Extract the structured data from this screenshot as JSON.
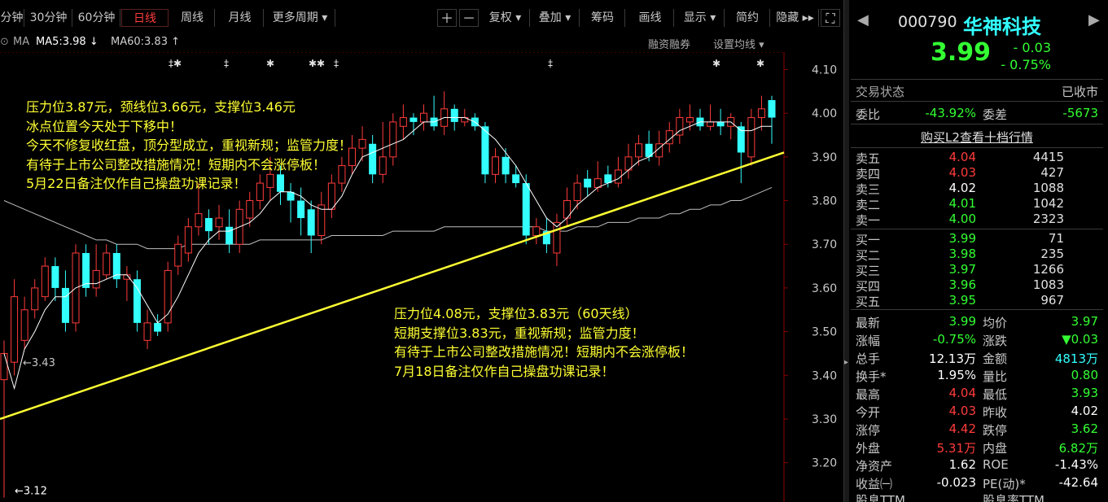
{
  "toolbar": {
    "periods": [
      "分钟",
      "30分钟",
      "60分钟",
      "日线",
      "周线",
      "月线",
      "更多周期 ▾"
    ],
    "tools": [
      "复权 ▾",
      "叠加 ▾",
      "筹码",
      "画线",
      "显示 ▾",
      "简约",
      "隐藏 ▸▸"
    ]
  },
  "ma_bar": {
    "ma_label": "MA",
    "ma5": "MA5:3.98 ↓",
    "ma60": "MA60:3.83 ↑",
    "rzrq": "融资融券",
    "set_ma": "设置均线 ▾"
  },
  "notes": {
    "top": [
      "压力位3.87元，颈线位3.66元，支撑位3.46元",
      "冰点位置今天处于下移中！",
      "今天不修复收红盘，顶分型成立，重视新规；监管力度！",
      "有待于上市公司整改措施情况！短期内不会涨停板！",
      "5月22日备注仅作自己操盘功课记录！"
    ],
    "bottom": [
      "压力位4.08元，支撑位3.83元（60天线）",
      "短期支撑位3.83元，重视新规；监管力度！",
      "有待于上市公司整改措施情况！短期内不会涨停板！",
      "7月18日备注仅作自己操盘功课记录！"
    ]
  },
  "chart_data": {
    "type": "candlestick",
    "yticks": [
      "4.10",
      "4.00",
      "3.90",
      "3.80",
      "3.70",
      "3.60",
      "3.50",
      "3.40",
      "3.30",
      "3.20"
    ],
    "ylim": [
      3.11,
      4.14
    ],
    "annotations": [
      "←3.43",
      "←3.12"
    ],
    "candles": [
      {
        "o": 3.39,
        "c": 3.45,
        "h": 3.48,
        "l": 3.12
      },
      {
        "o": 3.43,
        "c": 3.58,
        "h": 3.62,
        "l": 3.4
      },
      {
        "o": 3.48,
        "c": 3.55,
        "h": 3.58,
        "l": 3.46
      },
      {
        "o": 3.55,
        "c": 3.6,
        "h": 3.62,
        "l": 3.53
      },
      {
        "o": 3.58,
        "c": 3.65,
        "h": 3.67,
        "l": 3.57
      },
      {
        "o": 3.65,
        "c": 3.6,
        "h": 3.67,
        "l": 3.57
      },
      {
        "o": 3.6,
        "c": 3.52,
        "h": 3.64,
        "l": 3.5
      },
      {
        "o": 3.52,
        "c": 3.68,
        "h": 3.7,
        "l": 3.5
      },
      {
        "o": 3.68,
        "c": 3.6,
        "h": 3.7,
        "l": 3.58
      },
      {
        "o": 3.6,
        "c": 3.64,
        "h": 3.7,
        "l": 3.58
      },
      {
        "o": 3.63,
        "c": 3.68,
        "h": 3.7,
        "l": 3.62
      },
      {
        "o": 3.68,
        "c": 3.62,
        "h": 3.7,
        "l": 3.6
      },
      {
        "o": 3.62,
        "c": 3.63,
        "h": 3.65,
        "l": 3.57
      },
      {
        "o": 3.62,
        "c": 3.52,
        "h": 3.64,
        "l": 3.5
      },
      {
        "o": 3.48,
        "c": 3.52,
        "h": 3.55,
        "l": 3.46
      },
      {
        "o": 3.52,
        "c": 3.5,
        "h": 3.54,
        "l": 3.49
      },
      {
        "o": 3.52,
        "c": 3.64,
        "h": 3.66,
        "l": 3.5
      },
      {
        "o": 3.65,
        "c": 3.7,
        "h": 3.72,
        "l": 3.63
      },
      {
        "o": 3.68,
        "c": 3.74,
        "h": 3.76,
        "l": 3.66
      },
      {
        "o": 3.74,
        "c": 3.77,
        "h": 3.84,
        "l": 3.72
      },
      {
        "o": 3.76,
        "c": 3.73,
        "h": 3.78,
        "l": 3.7
      },
      {
        "o": 3.74,
        "c": 3.76,
        "h": 3.79,
        "l": 3.71
      },
      {
        "o": 3.74,
        "c": 3.7,
        "h": 3.78,
        "l": 3.68
      },
      {
        "o": 3.7,
        "c": 3.78,
        "h": 3.8,
        "l": 3.68
      },
      {
        "o": 3.76,
        "c": 3.8,
        "h": 3.82,
        "l": 3.74
      },
      {
        "o": 3.8,
        "c": 3.84,
        "h": 3.86,
        "l": 3.78
      },
      {
        "o": 3.83,
        "c": 3.86,
        "h": 3.9,
        "l": 3.8
      },
      {
        "o": 3.86,
        "c": 3.82,
        "h": 3.88,
        "l": 3.79
      },
      {
        "o": 3.82,
        "c": 3.8,
        "h": 3.84,
        "l": 3.75
      },
      {
        "o": 3.8,
        "c": 3.76,
        "h": 3.83,
        "l": 3.72
      },
      {
        "o": 3.78,
        "c": 3.72,
        "h": 3.8,
        "l": 3.68
      },
      {
        "o": 3.72,
        "c": 3.79,
        "h": 3.82,
        "l": 3.7
      },
      {
        "o": 3.78,
        "c": 3.84,
        "h": 3.86,
        "l": 3.76
      },
      {
        "o": 3.84,
        "c": 3.88,
        "h": 3.9,
        "l": 3.82
      },
      {
        "o": 3.88,
        "c": 3.92,
        "h": 3.95,
        "l": 3.86
      },
      {
        "o": 3.92,
        "c": 3.94,
        "h": 3.97,
        "l": 3.89
      },
      {
        "o": 3.93,
        "c": 3.86,
        "h": 3.95,
        "l": 3.84
      },
      {
        "o": 3.86,
        "c": 3.9,
        "h": 3.98,
        "l": 3.84
      },
      {
        "o": 3.9,
        "c": 3.98,
        "h": 4.0,
        "l": 3.88
      },
      {
        "o": 3.97,
        "c": 3.99,
        "h": 4.02,
        "l": 3.94
      },
      {
        "o": 3.99,
        "c": 3.98,
        "h": 4.0,
        "l": 3.95
      },
      {
        "o": 3.98,
        "c": 4.0,
        "h": 4.02,
        "l": 3.96
      },
      {
        "o": 3.99,
        "c": 3.97,
        "h": 4.04,
        "l": 3.96
      },
      {
        "o": 3.97,
        "c": 4.01,
        "h": 4.05,
        "l": 3.95
      },
      {
        "o": 4.01,
        "c": 3.98,
        "h": 4.02,
        "l": 3.96
      },
      {
        "o": 3.98,
        "c": 3.99,
        "h": 4.01,
        "l": 3.97
      },
      {
        "o": 3.99,
        "c": 3.97,
        "h": 4.0,
        "l": 3.96
      },
      {
        "o": 3.97,
        "c": 3.86,
        "h": 3.98,
        "l": 3.84
      },
      {
        "o": 3.86,
        "c": 3.9,
        "h": 3.92,
        "l": 3.84
      },
      {
        "o": 3.9,
        "c": 3.86,
        "h": 3.92,
        "l": 3.84
      },
      {
        "o": 3.86,
        "c": 3.84,
        "h": 3.88,
        "l": 3.83
      },
      {
        "o": 3.84,
        "c": 3.72,
        "h": 3.86,
        "l": 3.7
      },
      {
        "o": 3.72,
        "c": 3.74,
        "h": 3.76,
        "l": 3.7
      },
      {
        "o": 3.73,
        "c": 3.7,
        "h": 3.76,
        "l": 3.68
      },
      {
        "o": 3.68,
        "c": 3.75,
        "h": 3.77,
        "l": 3.65
      },
      {
        "o": 3.76,
        "c": 3.8,
        "h": 3.83,
        "l": 3.74
      },
      {
        "o": 3.8,
        "c": 3.84,
        "h": 3.86,
        "l": 3.78
      },
      {
        "o": 3.85,
        "c": 3.83,
        "h": 3.87,
        "l": 3.81
      },
      {
        "o": 3.83,
        "c": 3.85,
        "h": 3.89,
        "l": 3.82
      },
      {
        "o": 3.86,
        "c": 3.84,
        "h": 3.88,
        "l": 3.83
      },
      {
        "o": 3.84,
        "c": 3.87,
        "h": 3.9,
        "l": 3.83
      },
      {
        "o": 3.87,
        "c": 3.9,
        "h": 3.93,
        "l": 3.85
      },
      {
        "o": 3.9,
        "c": 3.93,
        "h": 3.95,
        "l": 3.88
      },
      {
        "o": 3.93,
        "c": 3.9,
        "h": 3.96,
        "l": 3.89
      },
      {
        "o": 3.9,
        "c": 3.93,
        "h": 3.96,
        "l": 3.88
      },
      {
        "o": 3.93,
        "c": 3.96,
        "h": 3.98,
        "l": 3.91
      },
      {
        "o": 3.95,
        "c": 3.99,
        "h": 4.01,
        "l": 3.93
      },
      {
        "o": 3.98,
        "c": 3.99,
        "h": 4.02,
        "l": 3.96
      },
      {
        "o": 3.99,
        "c": 3.97,
        "h": 4.01,
        "l": 3.96
      },
      {
        "o": 3.97,
        "c": 3.98,
        "h": 4.02,
        "l": 3.96
      },
      {
        "o": 3.98,
        "c": 3.97,
        "h": 4.01,
        "l": 3.95
      },
      {
        "o": 3.97,
        "c": 3.99,
        "h": 4.0,
        "l": 3.94
      },
      {
        "o": 3.97,
        "c": 3.91,
        "h": 3.98,
        "l": 3.84
      },
      {
        "o": 3.9,
        "c": 3.99,
        "h": 4.01,
        "l": 3.88
      },
      {
        "o": 3.99,
        "c": 4.01,
        "h": 4.04,
        "l": 3.96
      },
      {
        "o": 4.03,
        "c": 3.99,
        "h": 4.04,
        "l": 3.93
      }
    ],
    "ma5": [
      3.45,
      3.37,
      3.46,
      3.5,
      3.55,
      3.58,
      3.58,
      3.6,
      3.61,
      3.61,
      3.62,
      3.63,
      3.63,
      3.6,
      3.56,
      3.52,
      3.54,
      3.58,
      3.63,
      3.68,
      3.71,
      3.73,
      3.73,
      3.74,
      3.75,
      3.77,
      3.8,
      3.82,
      3.82,
      3.81,
      3.79,
      3.78,
      3.78,
      3.81,
      3.86,
      3.9,
      3.91,
      3.92,
      3.93,
      3.94,
      3.96,
      3.98,
      3.98,
      3.99,
      3.99,
      3.99,
      3.98,
      3.96,
      3.94,
      3.91,
      3.88,
      3.84,
      3.8,
      3.76,
      3.74,
      3.76,
      3.79,
      3.81,
      3.83,
      3.84,
      3.85,
      3.87,
      3.89,
      3.9,
      3.92,
      3.94,
      3.96,
      3.97,
      3.98,
      3.98,
      3.98,
      3.98,
      3.96,
      3.96,
      3.97,
      3.97
    ],
    "ma60": [
      3.8,
      3.79,
      3.78,
      3.77,
      3.76,
      3.75,
      3.74,
      3.73,
      3.72,
      3.71,
      3.71,
      3.7,
      3.7,
      3.7,
      3.69,
      3.69,
      3.69,
      3.69,
      3.7,
      3.7,
      3.7,
      3.7,
      3.7,
      3.7,
      3.7,
      3.71,
      3.71,
      3.71,
      3.71,
      3.71,
      3.71,
      3.71,
      3.72,
      3.72,
      3.72,
      3.72,
      3.72,
      3.72,
      3.73,
      3.73,
      3.73,
      3.73,
      3.73,
      3.74,
      3.74,
      3.74,
      3.74,
      3.74,
      3.74,
      3.74,
      3.74,
      3.74,
      3.74,
      3.73,
      3.73,
      3.73,
      3.74,
      3.74,
      3.74,
      3.75,
      3.75,
      3.75,
      3.76,
      3.76,
      3.76,
      3.77,
      3.77,
      3.78,
      3.78,
      3.79,
      3.79,
      3.8,
      3.8,
      3.81,
      3.82,
      3.83
    ],
    "trendline": {
      "from": 3.3,
      "to": 3.91
    },
    "markers": [
      "‡✱",
      "‡",
      "✱",
      "✱✱",
      "‡",
      "‡",
      "✱",
      "✱"
    ]
  },
  "quote": {
    "code": "000790",
    "name": "华神科技",
    "price": "3.99",
    "change": "- 0.03",
    "change_pct": "- 0.75%",
    "status_label": "交易状态",
    "status_value": "已收市",
    "weibi_label": "委比",
    "weibi": "-43.92%",
    "weicha_label": "委差",
    "weicha": "-5673",
    "l2_link": "购买L2查看十档行情",
    "asks": [
      {
        "label": "卖五",
        "price": "4.04",
        "vol": "4415",
        "color": "red"
      },
      {
        "label": "卖四",
        "price": "4.03",
        "vol": "427",
        "color": "red"
      },
      {
        "label": "卖三",
        "price": "4.02",
        "vol": "1088",
        "color": "white"
      },
      {
        "label": "卖二",
        "price": "4.01",
        "vol": "1042",
        "color": "green"
      },
      {
        "label": "卖一",
        "price": "4.00",
        "vol": "2323",
        "color": "green"
      }
    ],
    "bids": [
      {
        "label": "买一",
        "price": "3.99",
        "vol": "71",
        "color": "green"
      },
      {
        "label": "买二",
        "price": "3.98",
        "vol": "235",
        "color": "green"
      },
      {
        "label": "买三",
        "price": "3.97",
        "vol": "1266",
        "color": "green"
      },
      {
        "label": "买四",
        "price": "3.96",
        "vol": "1083",
        "color": "green"
      },
      {
        "label": "买五",
        "price": "3.95",
        "vol": "967",
        "color": "green"
      }
    ],
    "stats": [
      {
        "l1": "最新",
        "v1": "3.99",
        "c1": "green",
        "l2": "均价",
        "v2": "3.97",
        "c2": "green"
      },
      {
        "l1": "涨幅",
        "v1": "-0.75%",
        "c1": "green",
        "l2": "涨跌",
        "v2": "▼0.03",
        "c2": "green"
      },
      {
        "l1": "总手",
        "v1": "12.13万",
        "c1": "white",
        "l2": "金额",
        "v2": "4813万",
        "c2": "cyan"
      },
      {
        "l1": "换手*",
        "v1": "1.95%",
        "c1": "white",
        "l2": "量比",
        "v2": "0.80",
        "c2": "green"
      },
      {
        "l1": "最高",
        "v1": "4.04",
        "c1": "red",
        "l2": "最低",
        "v2": "3.93",
        "c2": "green"
      },
      {
        "l1": "今开",
        "v1": "4.03",
        "c1": "red",
        "l2": "昨收",
        "v2": "4.02",
        "c2": "white"
      },
      {
        "l1": "涨停",
        "v1": "4.42",
        "c1": "red",
        "l2": "跌停",
        "v2": "3.62",
        "c2": "green"
      },
      {
        "l1": "外盘",
        "v1": "5.31万",
        "c1": "red",
        "l2": "内盘",
        "v2": "6.82万",
        "c2": "green"
      },
      {
        "l1": "净资产",
        "v1": "1.62",
        "c1": "white",
        "l2": "ROE",
        "v2": "-1.43%",
        "c2": "white"
      },
      {
        "l1": "收益㈠",
        "v1": "-0.023",
        "c1": "white",
        "l2": "PE(动)*",
        "v2": "-42.64",
        "c2": "white"
      }
    ],
    "bottom_cut": [
      "股息TTM",
      "股息率TTM"
    ]
  },
  "colors": {
    "up": "#ff3b3b",
    "down": "#33ffff",
    "ma5": "#ffffff",
    "ma60": "#c0c0c0",
    "trend": "#ffff33",
    "grid": "#8b0000"
  }
}
